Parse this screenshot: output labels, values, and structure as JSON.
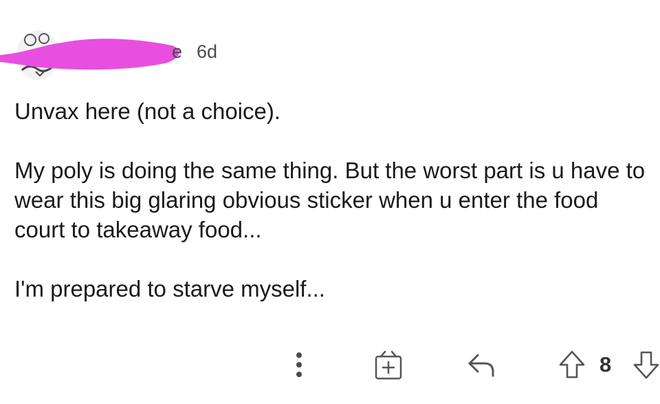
{
  "comment": {
    "username_visible": "e",
    "age": "6d",
    "paragraphs": [
      "Unvax here (not a choice).",
      "My poly is doing the same thing. But the worst part is u have to wear this big glaring obvious sticker when u enter the food court to takeaway food...",
      "I'm prepared to starve myself..."
    ],
    "score": "8"
  },
  "icons": {
    "more": "more-vertical-icon",
    "award": "gift-award-icon",
    "reply": "reply-arrow-icon",
    "upvote": "upvote-arrow-icon",
    "downvote": "downvote-arrow-icon"
  },
  "colors": {
    "redaction": "#e84fe0",
    "text": "#1a1a1b",
    "meta": "#4a4a4a"
  }
}
